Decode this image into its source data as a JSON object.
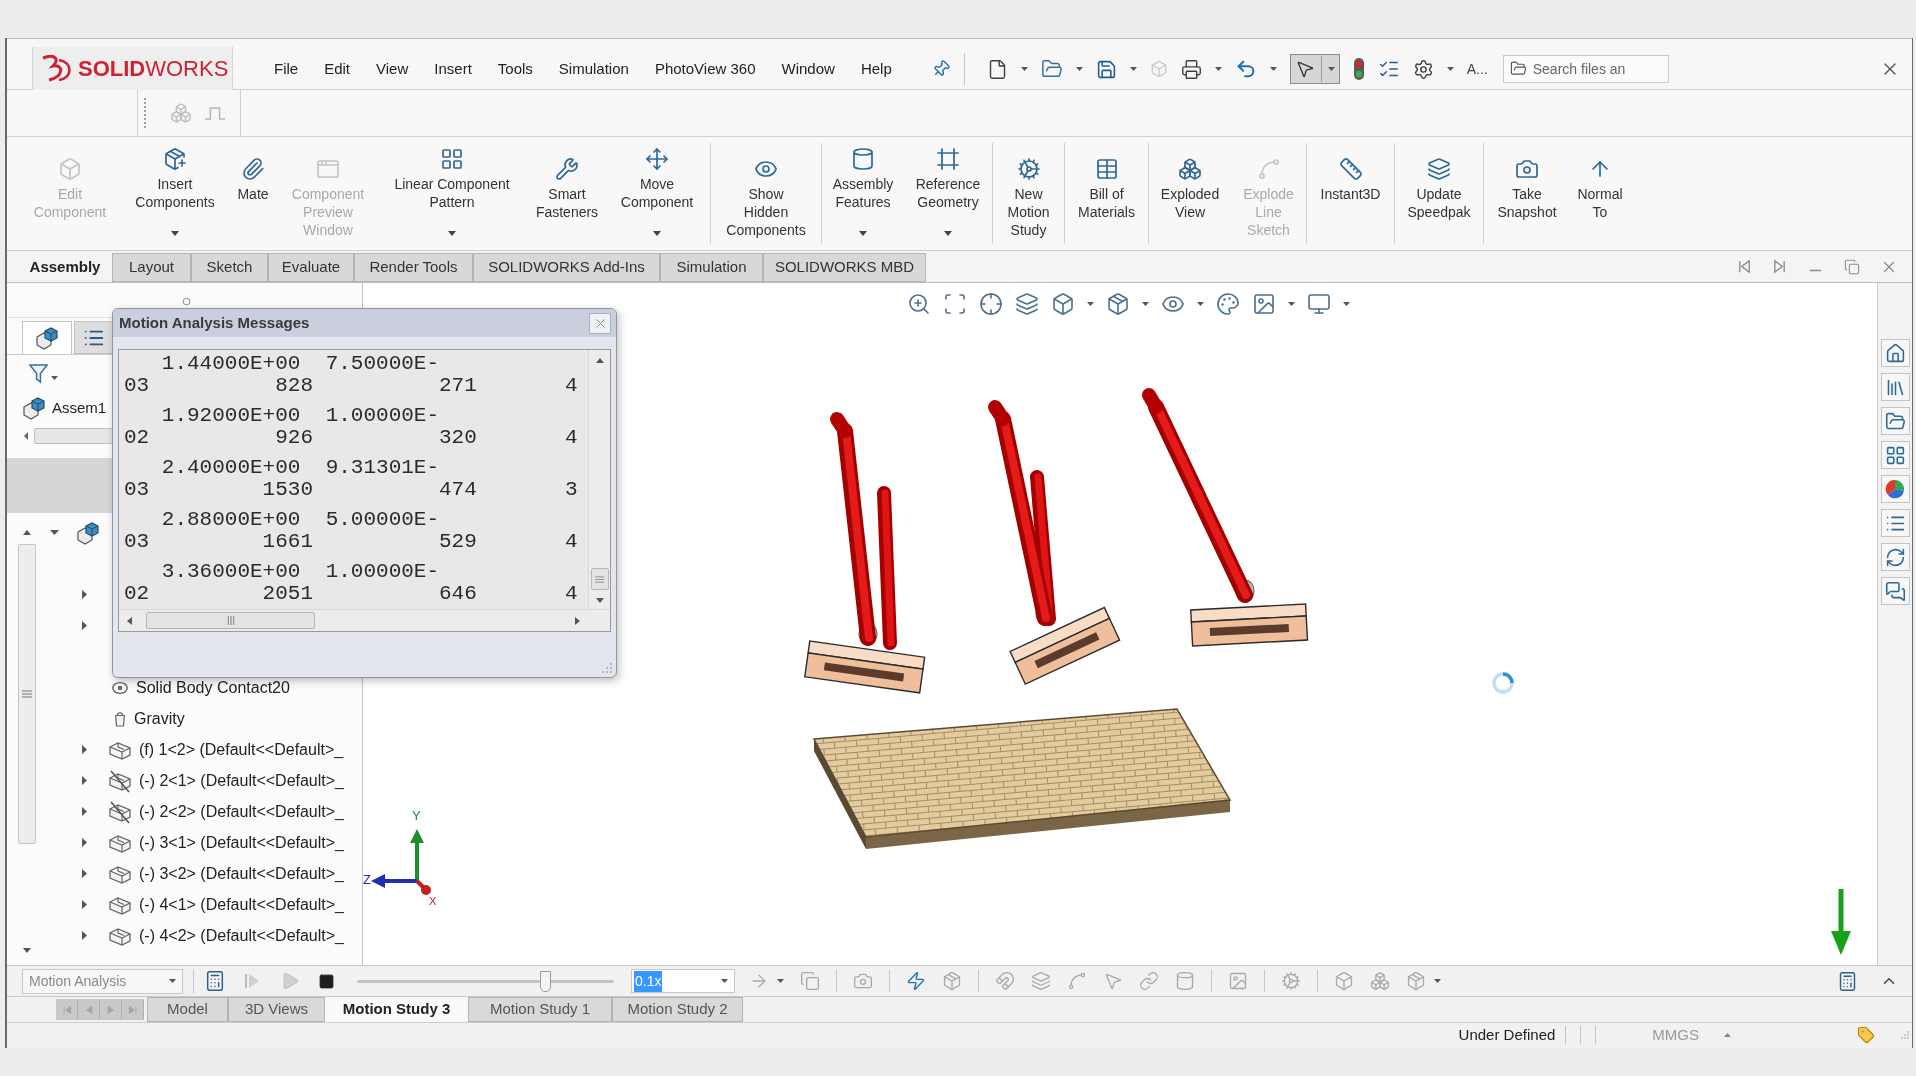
{
  "app": {
    "logo_text": "**SOLID**WORKS"
  },
  "menu": [
    "File",
    "Edit",
    "View",
    "Insert",
    "Tools",
    "Simulation",
    "PhotoView 360",
    "Window",
    "Help"
  ],
  "quick_access": {
    "select_tool": {
      "pressed": true
    },
    "overflow": "A...",
    "search": {
      "placeholder": "Search files an"
    }
  },
  "command_groups": [
    [
      {
        "label": "Edit\nComponent",
        "disabled": true,
        "dropdown": false
      },
      {
        "label": "Insert\nComponents",
        "disabled": false,
        "dropdown": true
      },
      {
        "label": "Mate",
        "disabled": false,
        "dropdown": false
      },
      {
        "label": "Component\nPreview\nWindow",
        "disabled": true,
        "dropdown": false
      },
      {
        "label": "Linear Component\nPattern",
        "disabled": false,
        "dropdown": true
      },
      {
        "label": "Smart\nFasteners",
        "disabled": false,
        "dropdown": false
      },
      {
        "label": "Move\nComponent",
        "disabled": false,
        "dropdown": true
      }
    ],
    [
      {
        "label": "Show\nHidden\nComponents",
        "disabled": false,
        "dropdown": false
      }
    ],
    [
      {
        "label": "Assembly\nFeatures",
        "disabled": false,
        "dropdown": true
      },
      {
        "label": "Reference\nGeometry",
        "disabled": false,
        "dropdown": true
      }
    ],
    [
      {
        "label": "New\nMotion\nStudy",
        "disabled": false,
        "dropdown": false
      }
    ],
    [
      {
        "label": "Bill of\nMaterials",
        "disabled": false,
        "dropdown": false
      }
    ],
    [
      {
        "label": "Exploded\nView",
        "disabled": false,
        "dropdown": false
      },
      {
        "label": "Explode\nLine\nSketch",
        "disabled": true,
        "dropdown": false
      }
    ],
    [
      {
        "label": "Instant3D",
        "disabled": false,
        "dropdown": false
      }
    ],
    [
      {
        "label": "Update\nSpeedpak",
        "disabled": false,
        "dropdown": false
      }
    ],
    [
      {
        "label": "Take\nSnapshot",
        "disabled": false,
        "dropdown": false
      },
      {
        "label": "Normal\nTo",
        "disabled": false,
        "dropdown": false
      }
    ]
  ],
  "command_tabs": [
    {
      "label": "Assembly",
      "selected": true
    },
    {
      "label": "Layout",
      "selected": false
    },
    {
      "label": "Sketch",
      "selected": false
    },
    {
      "label": "Evaluate",
      "selected": false
    },
    {
      "label": "Render Tools",
      "selected": false
    },
    {
      "label": "SOLIDWORKS Add-Ins",
      "selected": false
    },
    {
      "label": "Simulation",
      "selected": false
    },
    {
      "label": "SOLIDWORKS MBD",
      "selected": false
    }
  ],
  "feature_manager": {
    "tabs": [
      {
        "selected": true
      },
      {
        "selected": false
      }
    ],
    "assembly": "Assem1",
    "tree": {
      "root": {
        "expanded": true
      },
      "items": [
        {
          "expanded": false
        },
        {
          "expanded": false
        },
        {
          "kind": "contact",
          "label": "Solid Body Contact20"
        },
        {
          "kind": "gravity",
          "label": "Gravity"
        },
        {
          "kind": "part",
          "label": "(f) 1<2> (Default<<Default>_",
          "expanded": false,
          "slashed": false
        },
        {
          "kind": "part",
          "label": "(-) 2<1> (Default<<Default>_",
          "expanded": false,
          "slashed": true
        },
        {
          "kind": "part",
          "label": "(-) 2<2> (Default<<Default>_",
          "expanded": false,
          "slashed": true
        },
        {
          "kind": "part",
          "label": "(-) 3<1> (Default<<Default>_",
          "expanded": false,
          "slashed": false
        },
        {
          "kind": "part",
          "label": "(-) 3<2> (Default<<Default>_",
          "expanded": false,
          "slashed": false
        },
        {
          "kind": "part",
          "label": "(-) 4<1> (Default<<Default>_",
          "expanded": false,
          "slashed": false
        },
        {
          "kind": "part",
          "label": "(-) 4<2> (Default<<Default>_",
          "expanded": false,
          "slashed": false
        }
      ]
    }
  },
  "dialog": {
    "title": "Motion Analysis Messages",
    "records": [
      {
        "line_1": [
          "1.44000E+00",
          "7.50000E-"
        ],
        "line_2": [
          "03",
          "828",
          "271",
          "4"
        ]
      },
      {
        "line_1": [
          "1.92000E+00",
          "1.00000E-"
        ],
        "line_2": [
          "02",
          "926",
          "320",
          "4"
        ]
      },
      {
        "line_1": [
          "2.40000E+00",
          "9.31301E-"
        ],
        "line_2": [
          "03",
          "1530",
          "474",
          "3"
        ]
      },
      {
        "line_1": [
          "2.88000E+00",
          "5.00000E-"
        ],
        "line_2": [
          "03",
          "1661",
          "529",
          "4"
        ]
      },
      {
        "line_1": [
          "3.36000E+00",
          "1.00000E-"
        ],
        "line_2": [
          "02",
          "2051",
          "646",
          "4"
        ]
      }
    ]
  },
  "viewport": {
    "triad": {
      "y": "Y",
      "z": "Z",
      "x": "X"
    }
  },
  "motion_manager": {
    "study_type": "Motion Analysis",
    "timeline": {
      "level": 0.73
    },
    "playback_speed": {
      "value": "0.1x",
      "highlighted": true
    },
    "tabs": [
      {
        "label": "Model",
        "selected": false
      },
      {
        "label": "3D Views",
        "selected": false
      },
      {
        "label": "Motion Study 3",
        "selected": true
      },
      {
        "label": "Motion Study 1",
        "selected": false
      },
      {
        "label": "Motion Study 2",
        "selected": false
      }
    ]
  },
  "status_bar": {
    "state": "Under Defined",
    "units": "MMGS"
  }
}
